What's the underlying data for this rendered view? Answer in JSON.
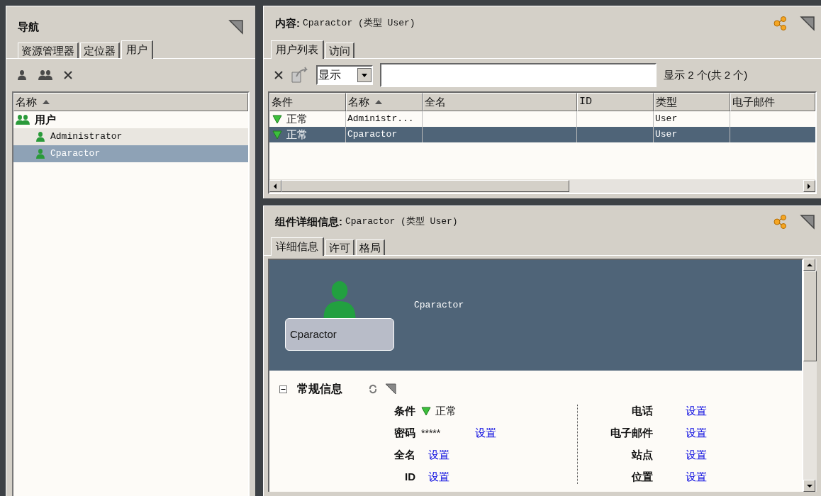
{
  "navigation": {
    "title": "导航",
    "tabs": [
      {
        "label": "资源管理器",
        "selected": false
      },
      {
        "label": "定位器",
        "selected": false
      },
      {
        "label": "用户",
        "selected": true
      }
    ],
    "column": {
      "label": "名称",
      "sorted": true
    },
    "tree": [
      {
        "label": "用户",
        "kind": "group",
        "selected": false,
        "children": [
          {
            "label": "Administrator",
            "kind": "user",
            "selected": false
          },
          {
            "label": "Cparactor",
            "kind": "user",
            "selected": true
          }
        ]
      }
    ]
  },
  "content": {
    "title_label": "内容:",
    "title_value": "Cparactor (类型 User)",
    "tabs": [
      {
        "label": "用户列表",
        "selected": true
      },
      {
        "label": "访问",
        "selected": false
      }
    ],
    "filter_select": "显示",
    "count_text": "显示 2 个(共 2 个)",
    "table": {
      "columns": [
        {
          "label": "条件",
          "sorted": false
        },
        {
          "label": "名称",
          "sorted": true
        },
        {
          "label": "全名",
          "sorted": false
        },
        {
          "label": "ID",
          "sorted": false
        },
        {
          "label": "类型",
          "sorted": false
        },
        {
          "label": "电子邮件",
          "sorted": false
        }
      ],
      "rows": [
        {
          "selected": false,
          "condition": "正常",
          "name": "Administr...",
          "type": "User"
        },
        {
          "selected": true,
          "condition": "正常",
          "name": "Cparactor",
          "type": "User"
        }
      ]
    }
  },
  "details": {
    "title_label": "组件详细信息:",
    "title_value": "Cparactor (类型 User)",
    "tabs": [
      {
        "label": "详细信息",
        "selected": true
      },
      {
        "label": "许可",
        "selected": false
      },
      {
        "label": "格局",
        "selected": false
      }
    ],
    "card_label": "Cparactor",
    "header_name": "Cparactor",
    "section": {
      "title": "常规信息",
      "expanded": true,
      "left_fields": [
        {
          "label": "条件",
          "kind": "status",
          "value": "正常"
        },
        {
          "label": "密码",
          "kind": "masked",
          "value": "*****",
          "link": "设置"
        },
        {
          "label": "全名",
          "kind": "link",
          "link": "设置"
        },
        {
          "label": "ID",
          "kind": "link",
          "link": "设置"
        }
      ],
      "right_fields": [
        {
          "label": "电话",
          "kind": "link",
          "link": "设置"
        },
        {
          "label": "电子邮件",
          "kind": "link",
          "link": "设置"
        },
        {
          "label": "站点",
          "kind": "link",
          "link": "设置"
        },
        {
          "label": "位置",
          "kind": "link",
          "link": "设置"
        }
      ]
    }
  }
}
